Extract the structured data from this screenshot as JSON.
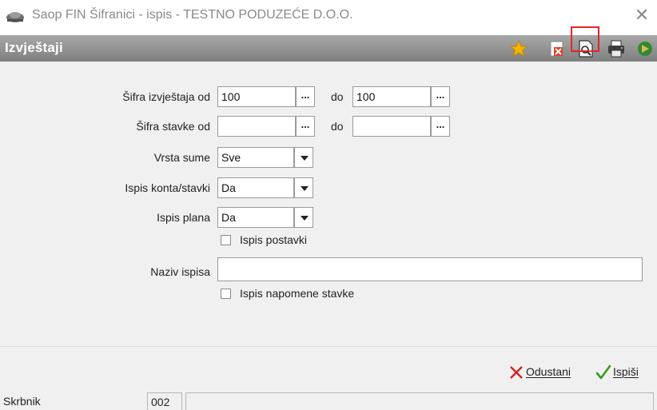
{
  "window": {
    "title": "Saop FIN Šifranici - ispis - TESTNO PODUZEĆE D.O.O.",
    "close_glyph": "✕"
  },
  "header": {
    "title": "Izvještaji",
    "toolbar_icons": [
      "star-icon",
      "delete-report-icon",
      "print-preview-icon",
      "printer-icon",
      "exit-icon"
    ]
  },
  "form": {
    "report_code": {
      "label": "Šifra izvještaja od",
      "from_value": "100",
      "to_label": "do",
      "to_value": "100"
    },
    "item_code": {
      "label": "Šifra stavke od",
      "from_value": "",
      "to_label": "do",
      "to_value": ""
    },
    "sum_type": {
      "label": "Vrsta sume",
      "value": "Sve"
    },
    "print_accounts": {
      "label": "Ispis konta/stavki",
      "value": "Da"
    },
    "print_plan": {
      "label": "Ispis plana",
      "value": "Da"
    },
    "print_settings_checkbox": {
      "label": "Ispis postavki",
      "checked": false
    },
    "print_name": {
      "label": "Naziv ispisa",
      "value": ""
    },
    "print_notes_checkbox": {
      "label": "Ispis napomene stavke",
      "checked": false
    },
    "dots": "..."
  },
  "footer": {
    "cancel_label": "Odustani",
    "print_label": "Ispiši",
    "cancel_color": "#d42020",
    "print_color": "#3a9a1a"
  },
  "statusbar": {
    "user": "Skrbnik",
    "code": "002",
    "extra": ""
  }
}
